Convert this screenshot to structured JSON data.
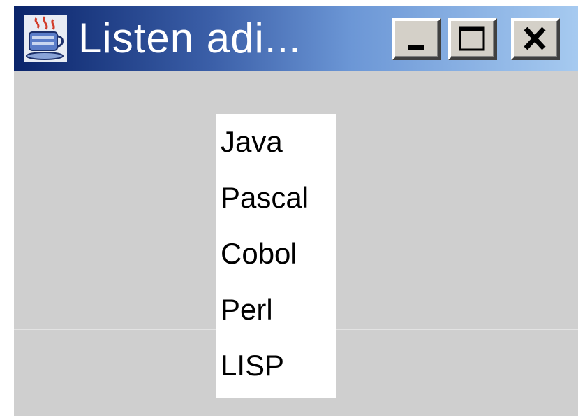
{
  "window": {
    "title": "Listen adi...",
    "icon": "java-cup-icon",
    "buttons": {
      "minimize": "minimize-icon",
      "maximize": "maximize-icon",
      "close": "close-icon"
    }
  },
  "list": {
    "items": [
      "Java",
      "Pascal",
      "Cobol",
      "Perl",
      "LISP"
    ]
  },
  "colors": {
    "titlebar_start": "#0a246a",
    "titlebar_end": "#a6caf0",
    "window_bg": "#cfcfcf",
    "list_bg": "#ffffff"
  }
}
